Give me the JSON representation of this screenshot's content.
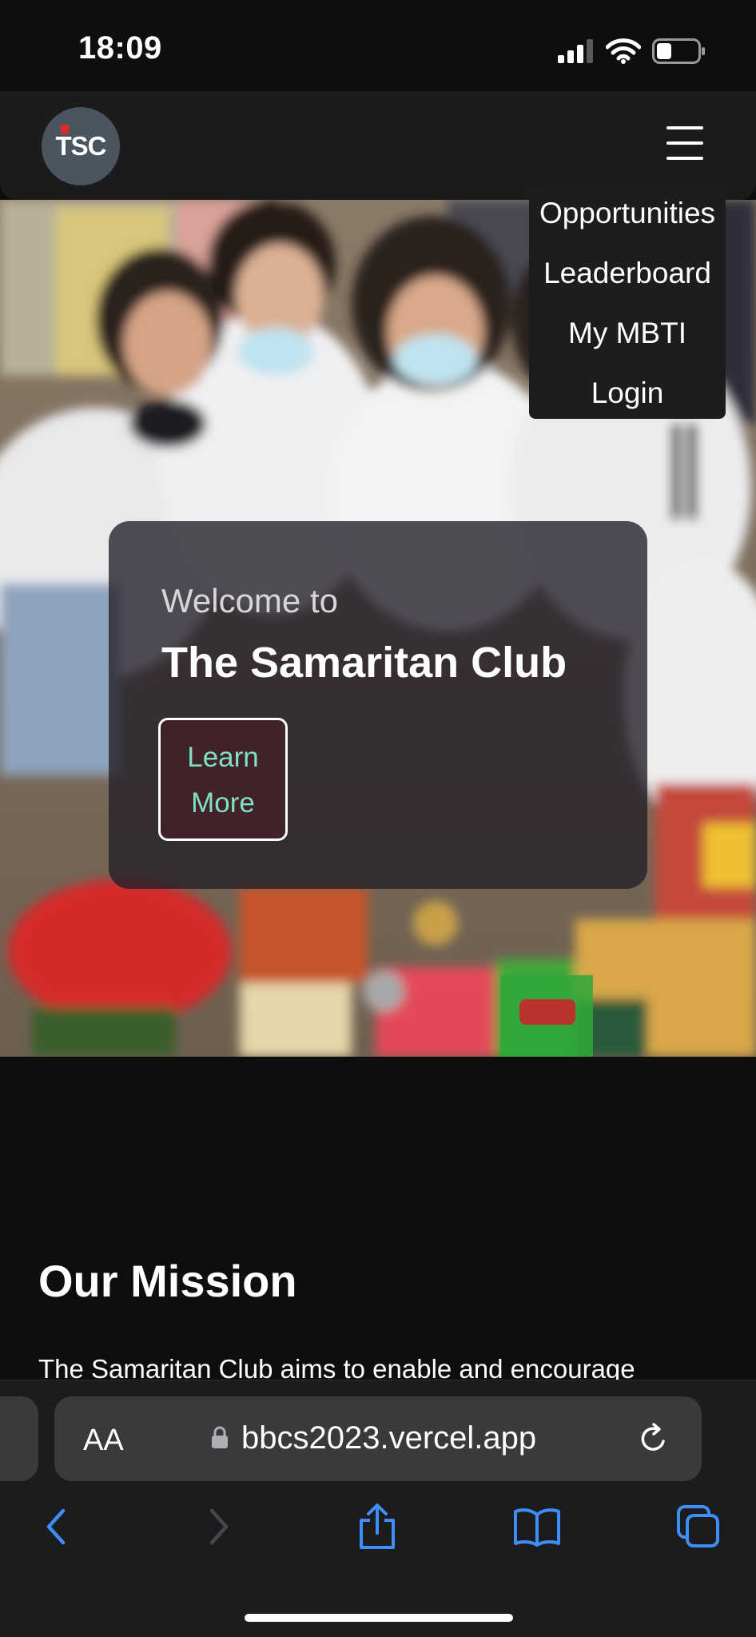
{
  "status_bar": {
    "time": "18:09",
    "icons": [
      "cellular-signal-icon",
      "wifi-icon",
      "battery-icon"
    ]
  },
  "nav": {
    "logo_text": "TSC",
    "menu_icon": "hamburger-icon"
  },
  "menu": {
    "items": [
      "Opportunities",
      "Leaderboard",
      "My MBTI",
      "Login"
    ]
  },
  "hero": {
    "welcome": "Welcome to",
    "title": "The Samaritan Club",
    "cta_line1": "Learn",
    "cta_line2": "More"
  },
  "mission": {
    "title": "Our Mission",
    "text": "The Samaritan Club aims to enable and encourage"
  },
  "browser": {
    "text_size_label": "AA",
    "url": "bbcs2023.vercel.app",
    "accent_color": "#3e8ef7",
    "toolbar_icons": [
      "back-icon",
      "forward-icon",
      "share-icon",
      "bookmarks-icon",
      "tabs-icon"
    ]
  }
}
